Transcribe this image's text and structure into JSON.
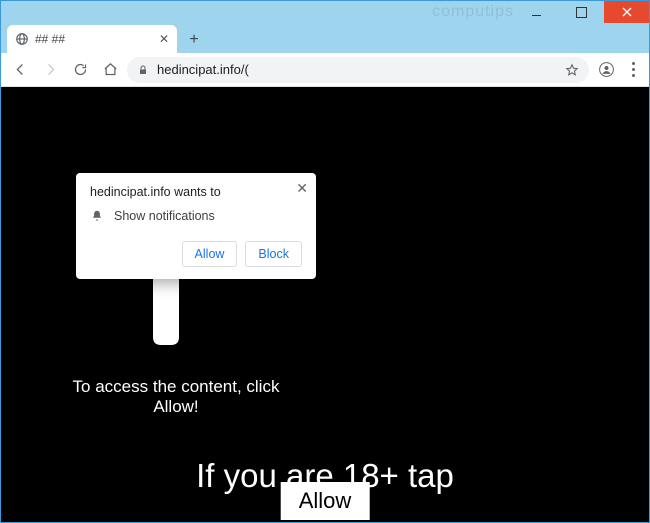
{
  "window": {
    "watermark": "computips"
  },
  "tab": {
    "title": "## ##"
  },
  "toolbar": {
    "url": "hedincipat.info/("
  },
  "permission_popup": {
    "origin_line": "hedincipat.info wants to",
    "request_label": "Show notifications",
    "allow_label": "Allow",
    "block_label": "Block"
  },
  "page": {
    "access_text": "To access the content, click Allow!",
    "age_text": "If you are 18+ tap",
    "allow_button": "Allow"
  }
}
